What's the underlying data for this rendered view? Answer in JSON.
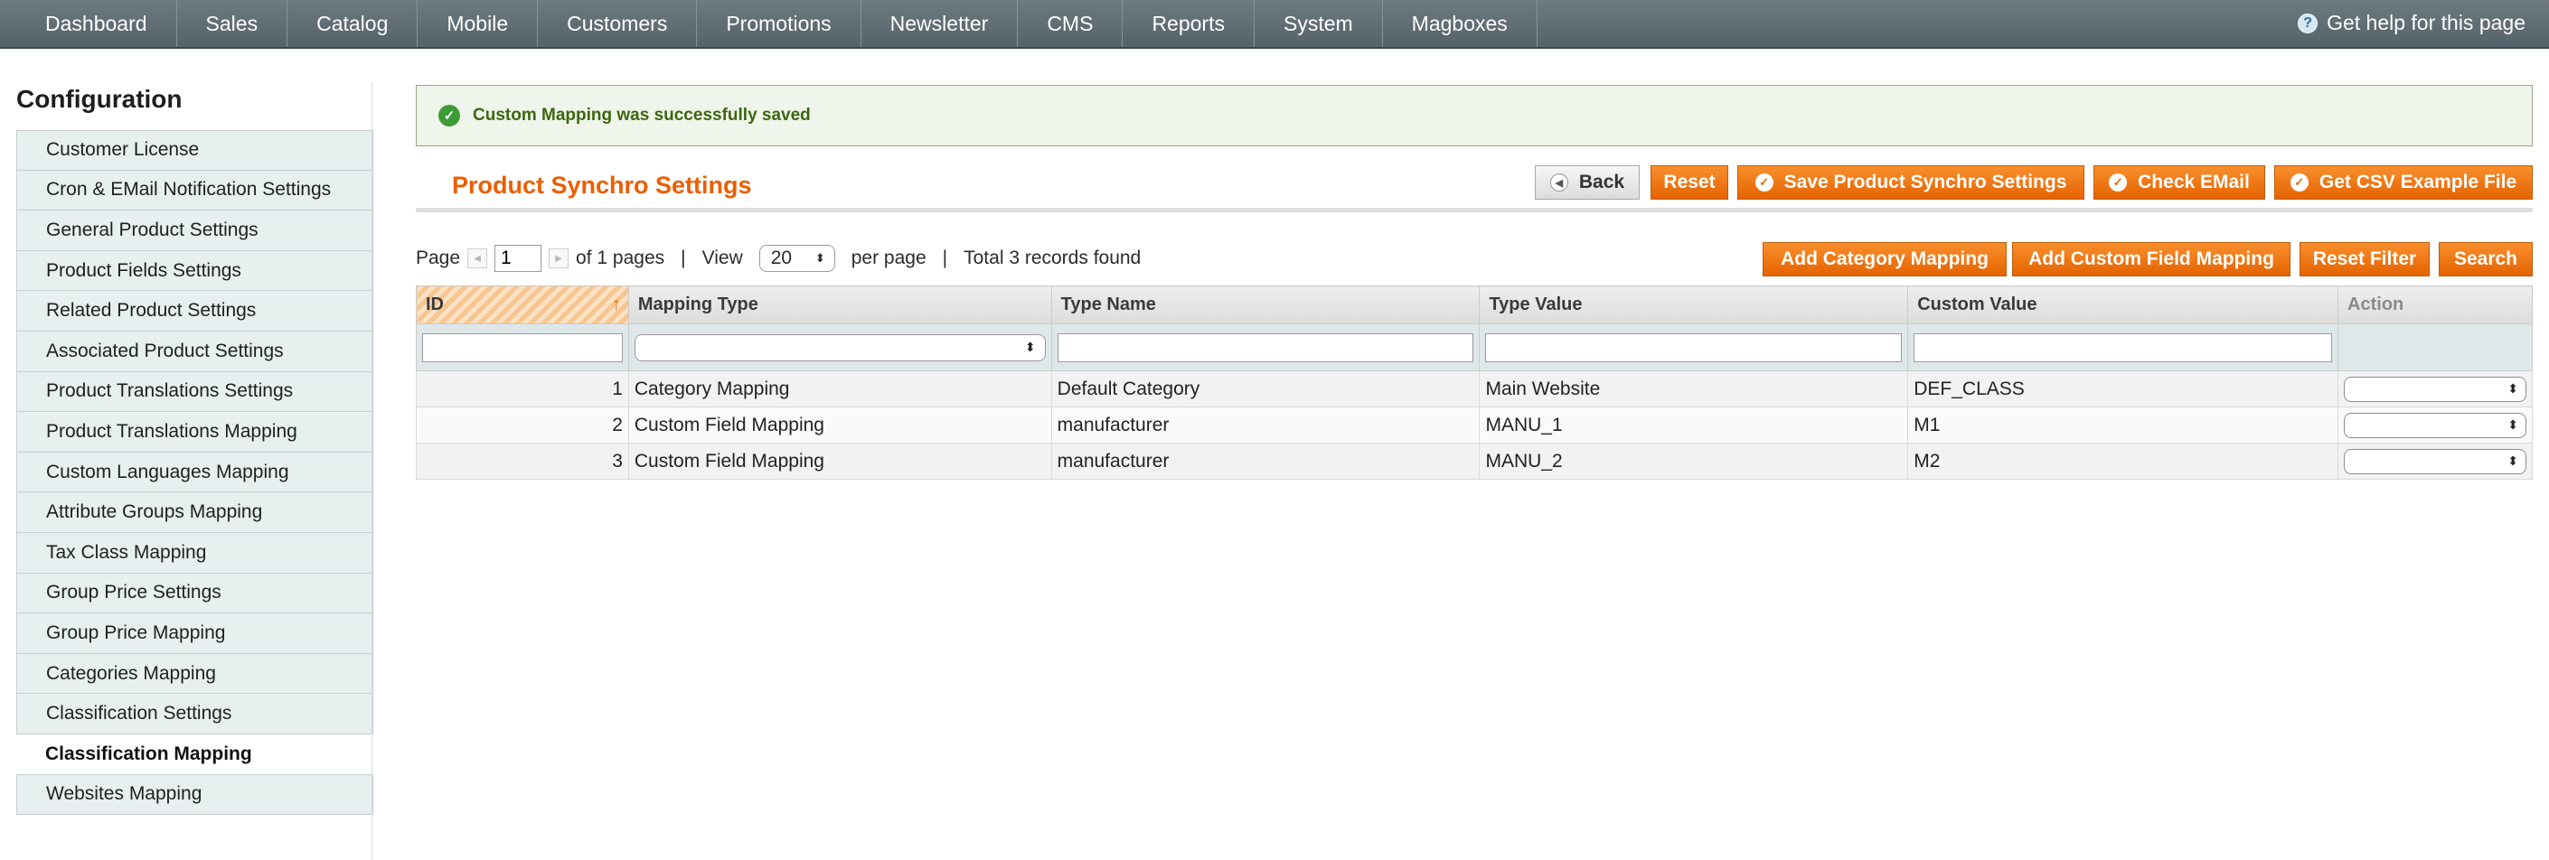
{
  "topnav": {
    "items": [
      "Dashboard",
      "Sales",
      "Catalog",
      "Mobile",
      "Customers",
      "Promotions",
      "Newsletter",
      "CMS",
      "Reports",
      "System",
      "Magboxes"
    ],
    "help": "Get help for this page"
  },
  "sidebar": {
    "title": "Configuration",
    "items": [
      "Customer License",
      "Cron & EMail Notification Settings",
      "General Product Settings",
      "Product Fields Settings",
      "Related Product Settings",
      "Associated Product Settings",
      "Product Translations Settings",
      "Product Translations Mapping",
      "Custom Languages Mapping",
      "Attribute Groups Mapping",
      "Tax Class Mapping",
      "Group Price Settings",
      "Group Price Mapping",
      "Categories Mapping",
      "Classification Settings",
      "Classification Mapping",
      "Websites Mapping"
    ],
    "active_index": 15
  },
  "message": "Custom Mapping was successfully saved",
  "page_title": "Product Synchro Settings",
  "buttons": {
    "back": "Back",
    "reset": "Reset",
    "save": "Save Product Synchro Settings",
    "check_email": "Check EMail",
    "csv": "Get CSV Example File",
    "add_category": "Add Category Mapping",
    "add_custom_field": "Add Custom Field Mapping",
    "reset_filter": "Reset Filter",
    "search": "Search"
  },
  "pager": {
    "page_label": "Page",
    "page_value": "1",
    "of_pages": "of 1 pages",
    "view_label": "View",
    "per_page_value": "20",
    "per_page_label": "per page",
    "total": "Total 3 records found"
  },
  "grid": {
    "columns": [
      "ID",
      "Mapping Type",
      "Type Name",
      "Type Value",
      "Custom Value",
      "Action"
    ],
    "rows": [
      {
        "id": "1",
        "mapping_type": "Category Mapping",
        "type_name": "Default Category",
        "type_value": "Main Website",
        "custom_value": "DEF_CLASS"
      },
      {
        "id": "2",
        "mapping_type": "Custom Field Mapping",
        "type_name": "manufacturer",
        "type_value": "MANU_1",
        "custom_value": "M1"
      },
      {
        "id": "3",
        "mapping_type": "Custom Field Mapping",
        "type_name": "manufacturer",
        "type_value": "MANU_2",
        "custom_value": "M2"
      }
    ]
  },
  "colors": {
    "accent": "#eb5e00",
    "nav_bg": "#5f6b72",
    "success": "#3d6611"
  }
}
